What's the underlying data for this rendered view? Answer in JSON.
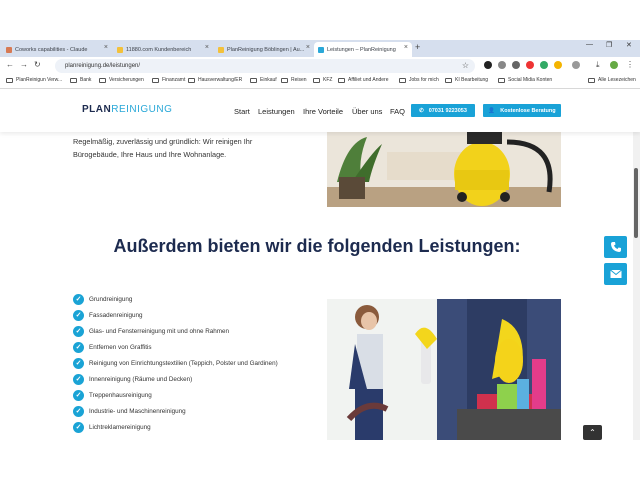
{
  "browser": {
    "tabs": [
      {
        "title": "Coworks capabilities - Claude",
        "fav": "#d77a54",
        "active": false
      },
      {
        "title": "11880.com Kundenbereich",
        "fav": "#f3c13a",
        "active": false
      },
      {
        "title": "PlanReinigung Böblingen | Au...",
        "fav": "#f3c13a",
        "active": false
      },
      {
        "title": "Leistungen – PlanReinigung",
        "fav": "#2aa8d8",
        "active": true
      }
    ],
    "url": "planreinigung.de/leistungen/",
    "bookmarks": [
      "PlanReinigun Verw...",
      "Bank",
      "Versicherungen",
      "Finanzamt",
      "Hausverwaltung/ER",
      "Einkauf",
      "Reisen",
      "KFZ",
      "Affiliet und Andere",
      "Jobs for mich",
      "KI Bearbeitung",
      "Social Midia Konten",
      "Alle Lesezeichen"
    ]
  },
  "site": {
    "logo_part1": "PLAN",
    "logo_part2": "REINIGUNG",
    "nav": [
      "Start",
      "Leistungen",
      "Ihre Vorteile",
      "Über uns",
      "FAQ"
    ],
    "phone_button": "07031 9223053",
    "contact_button": "Kostenlose Beratung",
    "intro_text": "Regelmäßig, zuverlässig und gründlich: Wir reinigen Ihr Bürogebäude, Ihre Haus und Ihre Wohnanlage.",
    "heading": "Außerdem bieten wir die folgenden Leistungen:",
    "services": [
      "Grundreinigung",
      "Fassadenreinigung",
      "Glas- und Fensterreinigung mit und ohne Rahmen",
      "Entfernen von Graffitis",
      "Reinigung von Einrichtungstextilien (Teppich, Polster und Gardinen)",
      "Innenreinigung (Räume und Decken)",
      "Treppenhausreinigung",
      "Industrie- und Maschinenreinigung",
      "Lichtreklamereinigung"
    ],
    "accent": "#19a2d7",
    "navy": "#1d2b4f"
  }
}
